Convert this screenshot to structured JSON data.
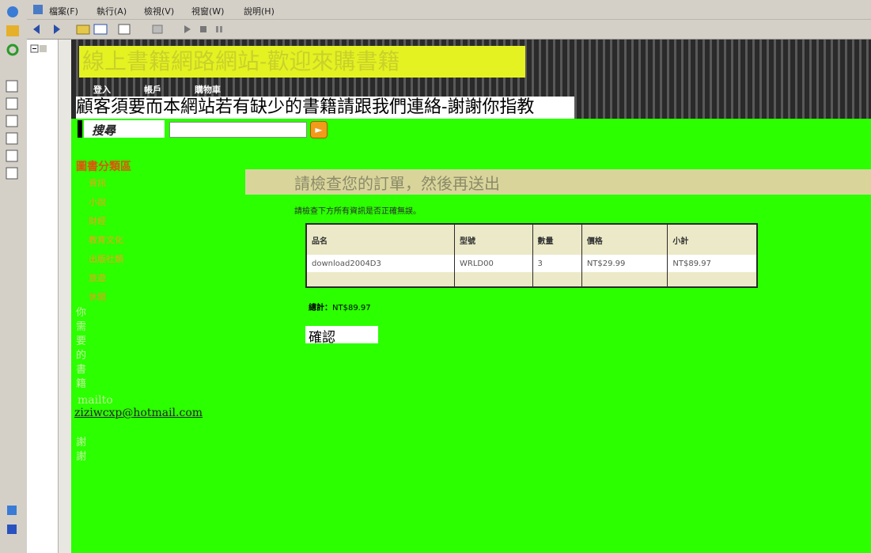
{
  "menubar": {
    "items": [
      "檔案(F)",
      "執行(A)",
      "檢視(V)",
      "視窗(W)",
      "說明(H)"
    ]
  },
  "toolbar": {
    "icons": [
      "back-icon",
      "forward-icon",
      "folder-icon",
      "window-icon",
      "properties-icon",
      "list-icon",
      "play-icon",
      "stop-icon",
      "pause-icon"
    ]
  },
  "site": {
    "logo_text": "線上書籍網路網站-歡迎來購書籍",
    "nav": {
      "login": "登入",
      "account": "帳戶",
      "cart": "購物車"
    },
    "notice": "顧客須要而本網站若有缺少的書籍請跟我們連絡-謝謝你指教",
    "search": {
      "label": "搜尋",
      "value": "",
      "placeholder": ""
    }
  },
  "sidebar": {
    "title": "圖書分類區",
    "categories": [
      "資訊",
      "小說",
      "財經",
      "教育文化",
      "出版社類",
      "旅遊",
      "休閒"
    ],
    "contact_chars": [
      "你",
      "需",
      "要",
      "的",
      "書",
      "籍"
    ],
    "mailto_label": "mailto",
    "email": "ziziwcxp@hotmail.com",
    "thanks_chars": [
      "謝",
      "謝"
    ]
  },
  "order": {
    "title": "請檢查您的訂單，然後再送出",
    "subtitle": "請檢查下方所有資訊是否正確無誤。",
    "columns": [
      "品名",
      "型號",
      "數量",
      "價格",
      "小計"
    ],
    "rows": [
      [
        "download2004D3",
        "WRLD00",
        "3",
        "NT$29.99",
        "NT$89.97"
      ]
    ],
    "total_label": "總計：",
    "total_value": "NT$89.97",
    "confirm_label": "確認"
  },
  "colors": {
    "page_bg": "#2bff00",
    "accent_orange": "#f29a1a",
    "category_title": "#e0530b"
  }
}
